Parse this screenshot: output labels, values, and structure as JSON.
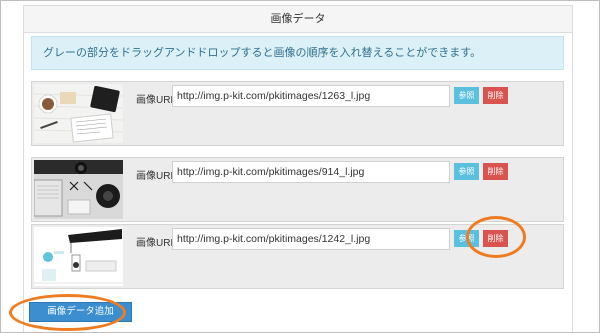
{
  "panel": {
    "title": "画像データ",
    "info": "グレーの部分をドラッグアンドドロップすると画像の順序を入れ替えることができます。"
  },
  "rows": [
    {
      "label": "画像URL:",
      "url": "http://img.p-kit.com/pkitimages/1263_l.jpg",
      "browse": "参照",
      "delete": "削除"
    },
    {
      "label": "画像URL:",
      "url": "http://img.p-kit.com/pkitimages/914_l.jpg",
      "browse": "参照",
      "delete": "削除"
    },
    {
      "label": "画像URL:",
      "url": "http://img.p-kit.com/pkitimages/1242_l.jpg",
      "browse": "参照",
      "delete": "削除"
    }
  ],
  "add_button": "画像データ追加",
  "colors": {
    "info_bg": "#dcf0f7",
    "info_text": "#31708f",
    "browse_button": "#5bc0de",
    "delete_button": "#d9534f",
    "add_button": "#3b8fd0",
    "highlight": "#f07c22"
  }
}
